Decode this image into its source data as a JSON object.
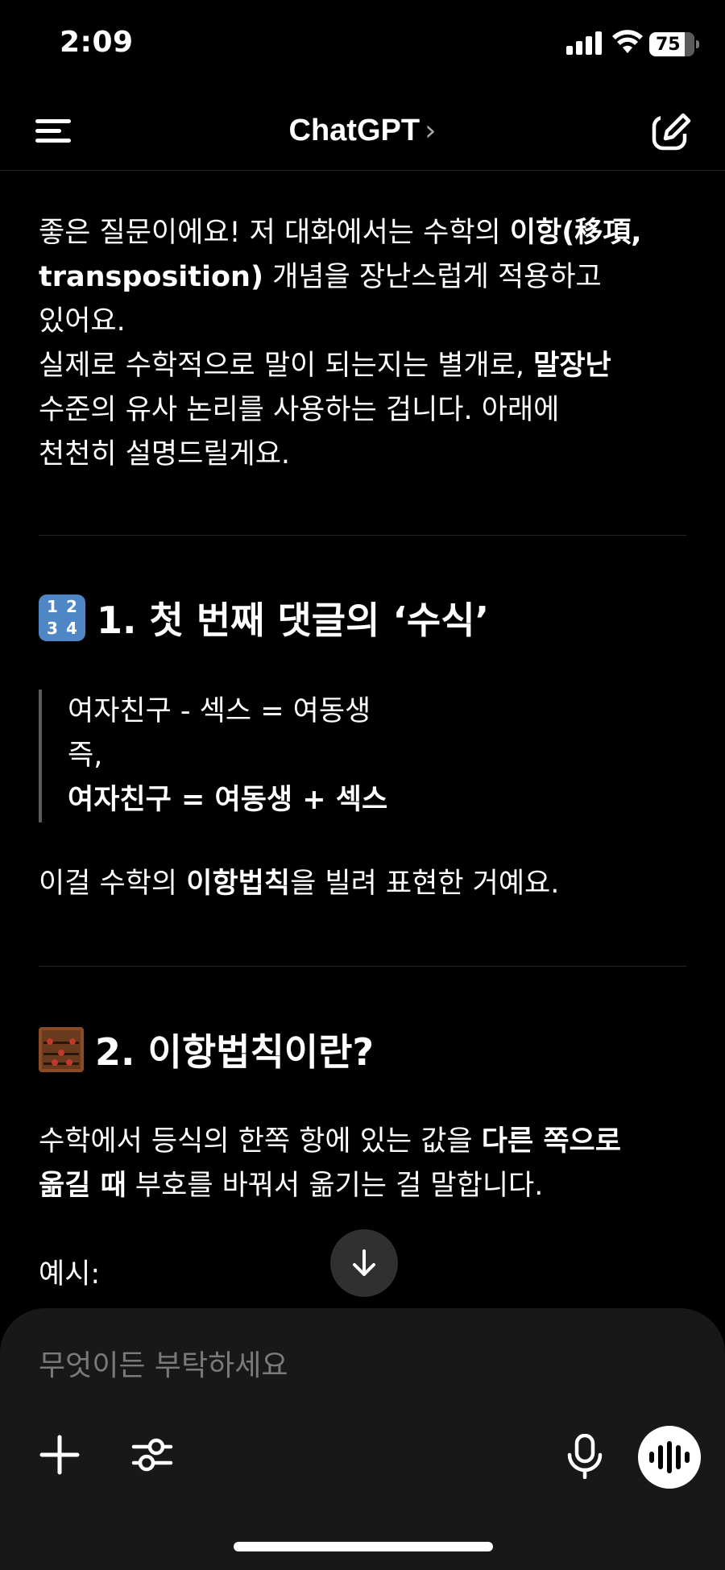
{
  "status_bar": {
    "time": "2:09",
    "battery": "75"
  },
  "header": {
    "title": "ChatGPT",
    "title_chevron": "›"
  },
  "message": {
    "intro_lines": {
      "l1_pre": "좋은 질문이에요! 저 대화에서는 수학의 ",
      "l1_bold": "이항(移項,",
      "l2_bold": "transposition)",
      "l2_post": " 개념을 장난스럽게 적용하고",
      "l3": "있어요.",
      "l4_pre": "실제로 수학적으로 말이 되는지는 별개로, ",
      "l4_bold": "말장난",
      "l5": "수준의 유사 논리를 사용하는 겁니다. 아래에",
      "l6": "천천히 설명드릴게요."
    },
    "section1": {
      "heading": "1. 첫 번째 댓글의 ‘수식’",
      "emoji_digits": [
        "1",
        "2",
        "3",
        "4"
      ],
      "quote_line1": "여자친구 - 섹스 = 여동생",
      "quote_line2": "즉,",
      "quote_line3": "여자친구 = 여동생 + 섹스",
      "para_pre": "이걸 수학의 ",
      "para_bold": "이항법칙",
      "para_post": "을 빌려 표현한 거예요."
    },
    "section2": {
      "heading": "2. 이항법칙이란?",
      "para_l1_pre": "수학에서 등식의 한쪽 항에 있는 값을 ",
      "para_l1_bold": "다른 쪽으로",
      "para_l2_bold": "옮길 때",
      "para_l2_post": " 부호를 바꿔서 옮기는 걸 말합니다.",
      "example_label": "예시:"
    }
  },
  "composer": {
    "placeholder": "무엇이든 부탁하세요"
  },
  "icons": {
    "menu": "menu-icon",
    "compose": "compose-icon",
    "scroll_down": "arrow-down-icon",
    "plus": "plus-icon",
    "tools": "sliders-icon",
    "mic": "mic-icon",
    "voice": "voice-waveform-icon"
  }
}
